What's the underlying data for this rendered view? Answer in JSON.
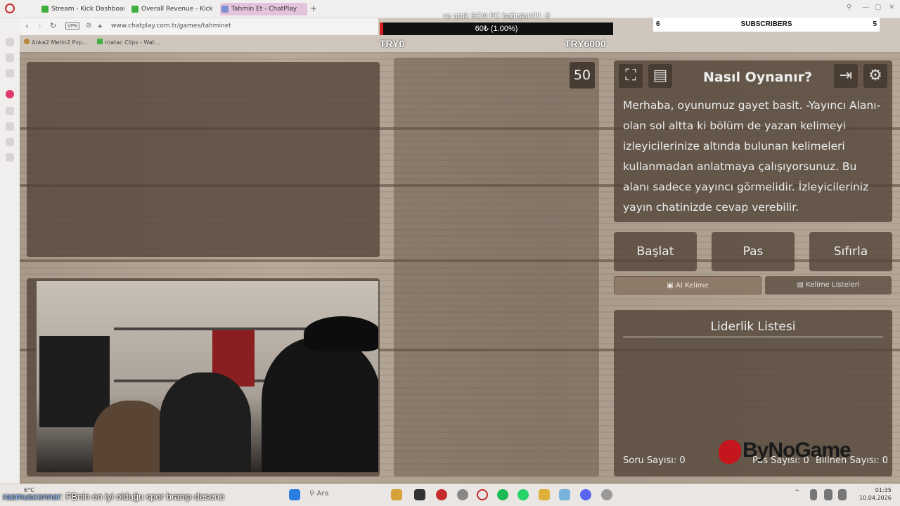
{
  "browser": {
    "tabs": [
      {
        "label": "Stream - Kick Dashboard"
      },
      {
        "label": "Overall Revenue - Kick Da"
      },
      {
        "label": "Tahmin Et - ChatPlay"
      }
    ],
    "url": "www.chatplay.com.tr/games/tahminet",
    "vpn_label": "VPN",
    "bookmarks": [
      {
        "label": "Anka2 Metin2 Pvp..."
      },
      {
        "label": "rnatac Clips - Wat..."
      }
    ]
  },
  "donation": {
    "title": "ve artık SON PC bağışları!!!! -3",
    "progress_text": "60₺ (1.00%)",
    "progress_percent": 1.0,
    "min_label": "TRY0",
    "max_label": "TRY6000"
  },
  "subscribers": {
    "left_count": "6",
    "label": "SUBSCRIBERS",
    "right_count": "5"
  },
  "game": {
    "counter": "50",
    "howto_title": "Nasıl Oynanır?",
    "howto_text": "Merhaba, oyunumuz gayet basit. -Yayıncı Alanı- olan sol altta ki bölüm de yazan kelimeyi izleyicilerinize altında bulunan kelimeleri kullanmadan anlatmaya çalışıyorsunuz. Bu alanı sadece yayıncı görmelidir. İzleyicileriniz yayın chatinizde cevap verebilir.",
    "buttons": {
      "start": "Başlat",
      "pass": "Pas",
      "reset": "Sıfırla",
      "ai_word": "AI Kelime",
      "word_lists": "Kelime Listeleri"
    },
    "leaderboard_title": "Liderlik Listesi",
    "stats": {
      "questions": "Soru Sayısı: 0",
      "pass_count": "Pas Sayısı: 0",
      "correct_count": "Bilinen Sayısı: 0"
    }
  },
  "sponsor": {
    "logo_text": "ByNoGame"
  },
  "chat": {
    "username": "rasmusconnor",
    "message": ": FBnin en iyi olduğu spor branşı desene"
  },
  "taskbar": {
    "search_placeholder": "Ara",
    "temperature": "6°C",
    "time": "01:35",
    "date": "10.04.2026"
  },
  "colors": {
    "wood_panel": "#50423a",
    "donation_fill": "#d21f1f",
    "sponsor_red": "#c4161c"
  }
}
